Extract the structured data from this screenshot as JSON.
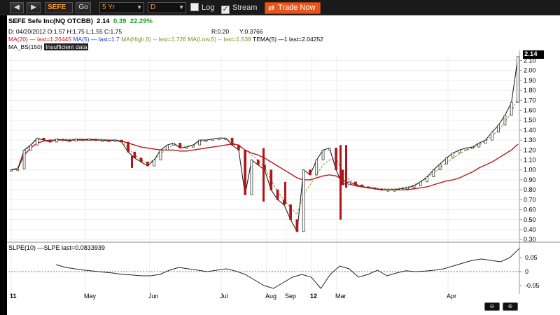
{
  "toolbar": {
    "back_icon": "◀",
    "forward_icon": "▶",
    "symbol": "SEFE",
    "go_label": "Go",
    "period": "5 Yr",
    "interval": "D",
    "log_label": "Log",
    "log_checked": false,
    "stream_label": "Stream",
    "stream_checked": true,
    "trade_label": "Trade Now"
  },
  "header": {
    "title": "SEFE Sefe Inc(NQ OTCBB)",
    "last": "2.14",
    "change": "0.39",
    "change_pct": "22.29%",
    "date_line": "D: 04/20/2012 O:1.57 H:1.75 L:1.55 C:1.75",
    "r_line": "R:0.20",
    "y_line": "Y:0.3766",
    "ma20": "MA(20) — last=1.26445",
    "ma5": "MA(5) — last=1.7",
    "mahigh": "MA(High,5) -- last=1.726",
    "malow": "MA(Low,5) -- last=1.538",
    "tema": "TEMA(5) —1 last=2.04252",
    "ma_bs": "MA_BS(150)",
    "insufficient": "Insufficient data"
  },
  "sub_panel": {
    "legend": "SLPE(10) —SLPE last=0.0833939"
  },
  "price_tag": "2.14",
  "colors": {
    "ma20": "#c0161b",
    "ma5": "#1a3cc8",
    "mahigh": "#8a8a20",
    "candle_down": "#b0151a",
    "accent": "#e8541a"
  },
  "chart_data": {
    "type": "line",
    "y_ticks": [
      "2.10",
      "2.00",
      "1.90",
      "1.80",
      "1.70",
      "1.60",
      "1.50",
      "1.40",
      "1.30",
      "1.20",
      "1.10",
      "1.00",
      "0.90",
      "0.80",
      "0.70",
      "0.60",
      "0.50",
      "0.40",
      "0.30"
    ],
    "x_labels": [
      "11",
      "May",
      "Jun",
      "Jul",
      "Aug",
      "Sep",
      "12",
      "Mar",
      "Apr"
    ],
    "sub_ticks": [
      "0.05",
      "0",
      "-0.05"
    ],
    "ylim": [
      0.28,
      2.16
    ],
    "sub_ylim": [
      -0.08,
      0.09
    ],
    "series": [
      {
        "name": "Price",
        "values": [
          1.0,
          1.01,
          1.2,
          1.25,
          1.32,
          1.3,
          1.28,
          1.31,
          1.3,
          1.29,
          1.31,
          1.3,
          1.31,
          1.3,
          1.3,
          1.29,
          1.3,
          1.28,
          1.18,
          1.12,
          1.08,
          1.04,
          1.1,
          1.2,
          1.25,
          1.27,
          1.22,
          1.23,
          1.25,
          1.3,
          1.3,
          1.31,
          1.32,
          1.32,
          1.25,
          1.2,
          0.75,
          1.1,
          1.05,
          1.0,
          0.8,
          0.7,
          0.65,
          0.5,
          0.38,
          1.0,
          0.95,
          1.1,
          1.2,
          1.22,
          1.0,
          0.85,
          0.88,
          0.85,
          0.83,
          0.82,
          0.81,
          0.8,
          0.8,
          0.8,
          0.81,
          0.82,
          0.84,
          0.88,
          0.93,
          1.0,
          1.06,
          1.12,
          1.17,
          1.2,
          1.22,
          1.23,
          1.27,
          1.3,
          1.38,
          1.45,
          1.55,
          1.68,
          2.14
        ]
      },
      {
        "name": "MA(20)",
        "values": [
          1.0,
          1.01,
          1.15,
          1.22,
          1.27,
          1.29,
          1.3,
          1.3,
          1.3,
          1.3,
          1.3,
          1.3,
          1.3,
          1.3,
          1.3,
          1.3,
          1.3,
          1.29,
          1.27,
          1.25,
          1.23,
          1.22,
          1.21,
          1.2,
          1.2,
          1.2,
          1.19,
          1.19,
          1.2,
          1.21,
          1.22,
          1.23,
          1.24,
          1.25,
          1.26,
          1.25,
          1.2,
          1.17,
          1.15,
          1.12,
          1.08,
          1.04,
          1.0,
          0.96,
          0.92,
          0.9,
          0.9,
          0.92,
          0.94,
          0.95,
          0.94,
          0.9,
          0.86,
          0.84,
          0.83,
          0.82,
          0.81,
          0.8,
          0.8,
          0.8,
          0.8,
          0.8,
          0.81,
          0.82,
          0.83,
          0.85,
          0.87,
          0.89,
          0.9,
          0.92,
          0.95,
          0.98,
          1.02,
          1.05,
          1.08,
          1.12,
          1.16,
          1.2,
          1.26
        ]
      },
      {
        "name": "MA(High,5)",
        "values": [
          1.0,
          1.02,
          1.18,
          1.25,
          1.3,
          1.31,
          1.3,
          1.3,
          1.31,
          1.31,
          1.31,
          1.31,
          1.31,
          1.31,
          1.31,
          1.3,
          1.3,
          1.29,
          1.22,
          1.15,
          1.1,
          1.07,
          1.1,
          1.16,
          1.22,
          1.25,
          1.24,
          1.24,
          1.25,
          1.28,
          1.3,
          1.31,
          1.32,
          1.32,
          1.28,
          1.24,
          1.2,
          1.15,
          1.1,
          1.02,
          0.9,
          0.78,
          0.7,
          0.62,
          0.55,
          0.75,
          0.85,
          0.95,
          1.05,
          1.1,
          1.12,
          0.98,
          0.9,
          0.86,
          0.84,
          0.83,
          0.82,
          0.81,
          0.81,
          0.81,
          0.82,
          0.83,
          0.85,
          0.88,
          0.92,
          0.97,
          1.02,
          1.07,
          1.12,
          1.16,
          1.2,
          1.22,
          1.25,
          1.29,
          1.34,
          1.4,
          1.48,
          1.58,
          1.73
        ]
      }
    ],
    "slpe": [
      0.025,
      0.015,
      0.01,
      0.005,
      0.002,
      -0.002,
      -0.005,
      -0.01,
      -0.012,
      -0.015,
      -0.015,
      -0.01,
      0.005,
      0.015,
      0.01,
      0.005,
      0.0,
      0.005,
      0.01,
      0.002,
      -0.01,
      -0.03,
      -0.05,
      -0.06,
      -0.04,
      -0.02,
      -0.01,
      -0.02,
      -0.06,
      -0.01,
      0.02,
      0.01,
      -0.02,
      -0.01,
      0.005,
      -0.015,
      -0.005,
      0.003,
      0.0,
      0.002,
      0.005,
      0.01,
      0.02,
      0.03,
      0.04,
      0.045,
      0.04,
      0.035,
      0.05,
      0.083
    ]
  }
}
